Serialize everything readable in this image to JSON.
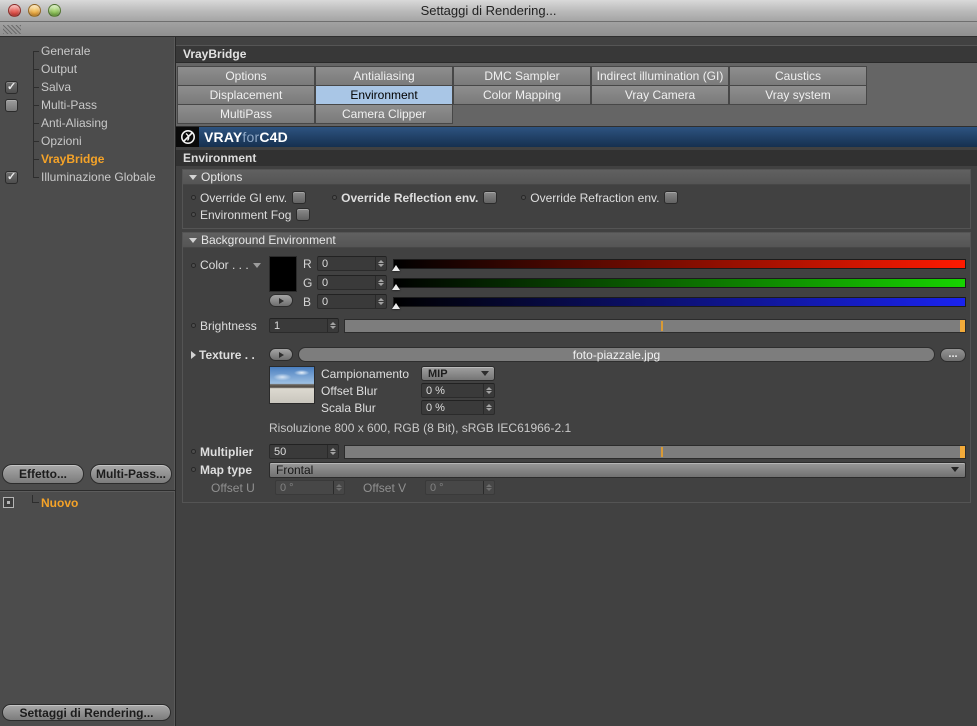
{
  "window": {
    "title": "Settaggi di Rendering..."
  },
  "icons": {
    "check": "✓",
    "ellipsis": "...",
    "collapse": "▼",
    "expand": "▶"
  },
  "colors": {
    "accent_orange": "#f5a328",
    "selected_tab_blue": "#a9c6e6",
    "logo_navy": "#1d3b60",
    "channel_red": "#ff1a00",
    "channel_green": "#17d400",
    "channel_blue": "#1a23f0",
    "swatch": "#000000"
  },
  "sidebar": {
    "items": [
      {
        "label": "Generale",
        "checkbox": "none",
        "selected": false
      },
      {
        "label": "Output",
        "checkbox": "none",
        "selected": false
      },
      {
        "label": "Salva",
        "checkbox": "checked",
        "selected": false
      },
      {
        "label": "Multi-Pass",
        "checkbox": "unchecked",
        "selected": false
      },
      {
        "label": "Anti-Aliasing",
        "checkbox": "none",
        "selected": false
      },
      {
        "label": "Opzioni",
        "checkbox": "none",
        "selected": false
      },
      {
        "label": "VrayBridge",
        "checkbox": "none",
        "selected": true
      },
      {
        "label": "Illuminazione Globale",
        "checkbox": "checked",
        "selected": false
      }
    ],
    "effect_button": "Effetto...",
    "multipass_button": "Multi-Pass...",
    "new_item": "Nuovo",
    "render_settings_button": "Settaggi di Rendering..."
  },
  "main": {
    "panel_title": "VrayBridge",
    "tabs": [
      {
        "label": "Options",
        "selected": false
      },
      {
        "label": "Antialiasing",
        "selected": false
      },
      {
        "label": "DMC Sampler",
        "selected": false
      },
      {
        "label": "Indirect illumination (GI)",
        "selected": false
      },
      {
        "label": "Caustics",
        "selected": false
      },
      {
        "label": "Displacement",
        "selected": false
      },
      {
        "label": "Environment",
        "selected": true
      },
      {
        "label": "Color Mapping",
        "selected": false
      },
      {
        "label": "Vray Camera",
        "selected": false
      },
      {
        "label": "Vray system",
        "selected": false
      },
      {
        "label": "MultiPass",
        "selected": false
      },
      {
        "label": "Camera Clipper",
        "selected": false
      }
    ],
    "logo": {
      "brand_bold1": "VRAY",
      "brand_light": "for",
      "brand_bold2": "C4D"
    },
    "section_title": "Environment",
    "options_group": {
      "title": "Options",
      "checkboxes": [
        {
          "label": "Override GI env.",
          "bold": false,
          "checked": false
        },
        {
          "label": "Override Reflection env.",
          "bold": true,
          "checked": false
        },
        {
          "label": "Override Refraction env.",
          "bold": false,
          "checked": false
        },
        {
          "label": "Environment Fog",
          "bold": false,
          "checked": false
        }
      ]
    },
    "background_group": {
      "title": "Background Environment",
      "color": {
        "label": "Color . . .",
        "channels": [
          {
            "name": "R",
            "value": "0"
          },
          {
            "name": "G",
            "value": "0"
          },
          {
            "name": "B",
            "value": "0"
          }
        ]
      },
      "brightness": {
        "label": "Brightness",
        "value": "1"
      },
      "texture": {
        "label": "Texture . .",
        "file": "foto-piazzale.jpg",
        "browse": "...",
        "sampling_label": "Campionamento",
        "sampling_value": "MIP",
        "offset_blur_label": "Offset Blur",
        "offset_blur_value": "0 %",
        "scale_blur_label": "Scala Blur",
        "scale_blur_value": "0 %",
        "resolution": "Risoluzione 800 x 600, RGB (8 Bit), sRGB IEC61966-2.1"
      },
      "multiplier": {
        "label": "Multiplier",
        "value": "50"
      },
      "map_type": {
        "label": "Map type",
        "value": "Frontal"
      },
      "offset_u": {
        "label": "Offset U",
        "value": "0 °"
      },
      "offset_v": {
        "label": "Offset V",
        "value": "0 °"
      }
    }
  }
}
